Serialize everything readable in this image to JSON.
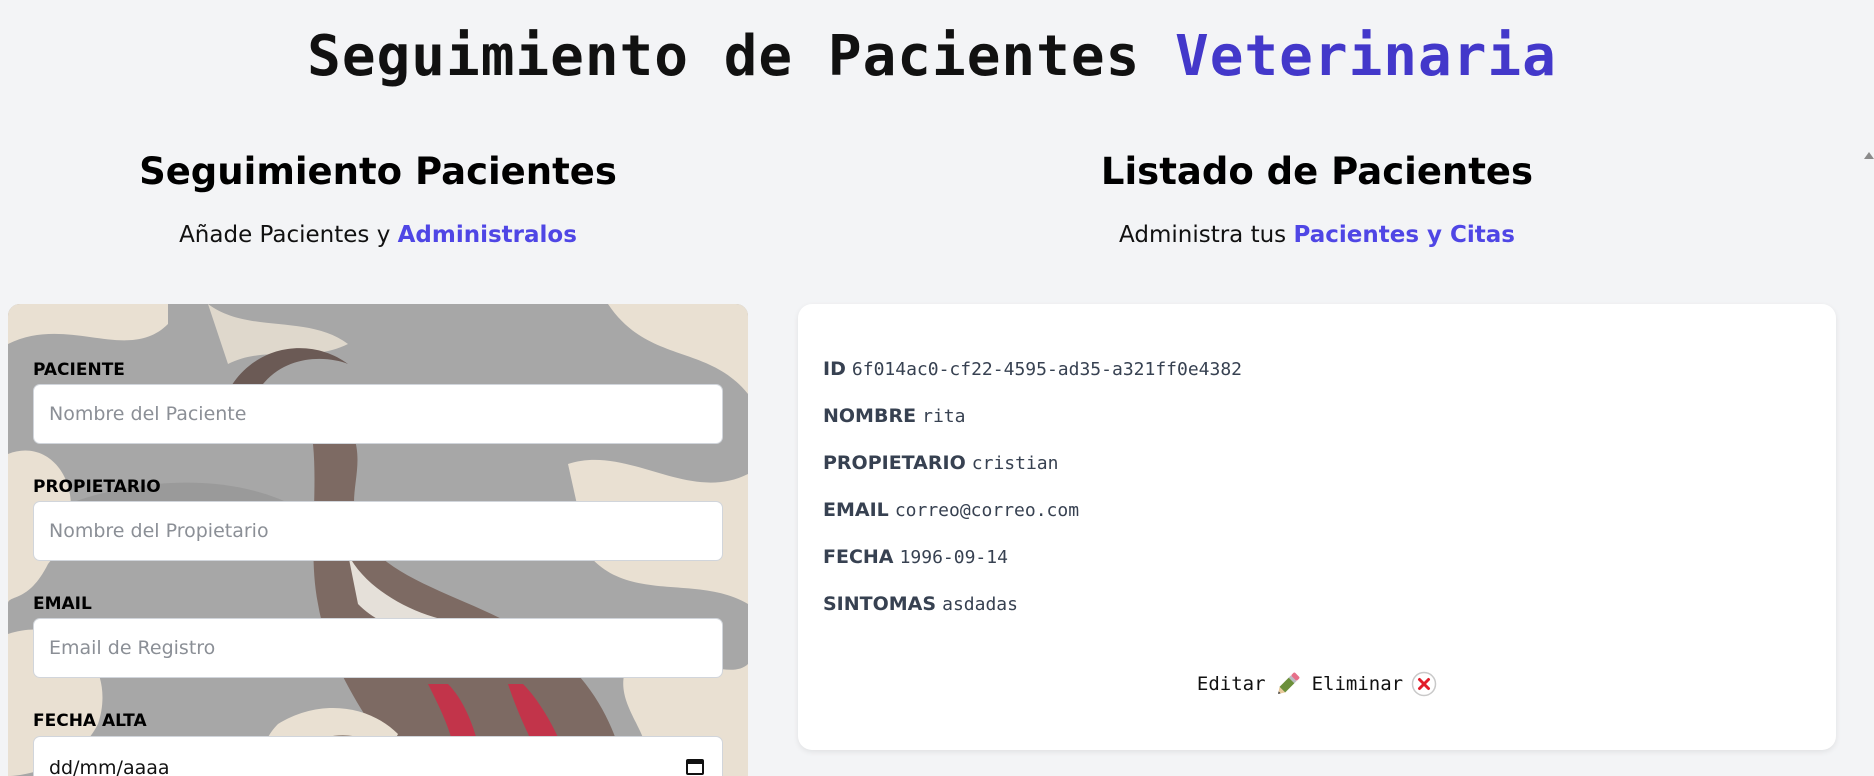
{
  "header": {
    "title_main": "Seguimiento de Pacientes",
    "title_accent": "Veterinaria"
  },
  "form_section": {
    "heading": "Seguimiento Pacientes",
    "subtitle": "Añade Pacientes y",
    "subtitle_accent": "Administralos",
    "fields": {
      "paciente": {
        "label": "PACIENTE",
        "placeholder": "Nombre del Paciente",
        "value": ""
      },
      "propietario": {
        "label": "PROPIETARIO",
        "placeholder": "Nombre del Propietario",
        "value": ""
      },
      "email": {
        "label": "EMAIL",
        "placeholder": "Email de Registro",
        "value": ""
      },
      "fecha": {
        "label": "FECHA ALTA",
        "value": "dd/mm/aaaa"
      }
    }
  },
  "list_section": {
    "heading": "Listado de Pacientes",
    "subtitle": "Administra tus",
    "subtitle_accent": "Pacientes y Citas",
    "patient": {
      "id_label": "ID",
      "id": "6f014ac0-cf22-4595-ad35-a321ff0e4382",
      "nombre_label": "NOMBRE",
      "nombre": "rita",
      "propietario_label": "PROPIETARIO",
      "propietario": "cristian",
      "email_label": "EMAIL",
      "email": "correo@correo.com",
      "fecha_label": "FECHA",
      "fecha": "1996-09-14",
      "sintomas_label": "SINTOMAS",
      "sintomas": "asdadas"
    },
    "actions": {
      "edit_label": "Editar",
      "delete_label": "Eliminar"
    }
  },
  "icons": {
    "edit": "pencil-icon",
    "delete": "close-circle-icon",
    "calendar": "calendar-icon"
  },
  "colors": {
    "accent": "#4338ca",
    "accent_light": "#4f46e5",
    "background": "#f3f4f6",
    "delete_red": "#e11d2a"
  }
}
